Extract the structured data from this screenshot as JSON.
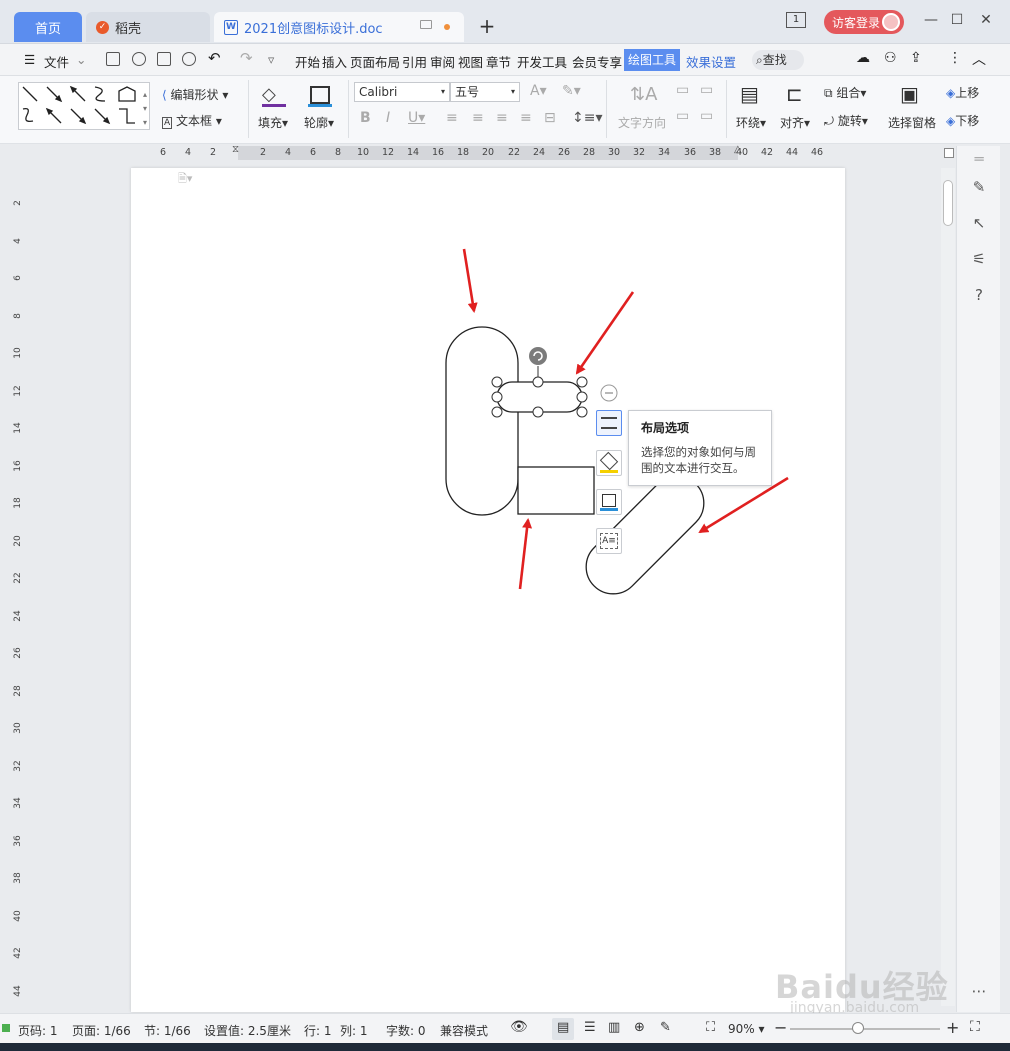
{
  "tabs": {
    "home": "首页",
    "daoke": "稻壳",
    "doc": "2021创意图标设计.doc",
    "new_tab": "+"
  },
  "header": {
    "page_badge": "1",
    "login": "访客登录"
  },
  "menu": {
    "file": "文件",
    "items": [
      "开始",
      "插入",
      "页面布局",
      "引用",
      "审阅",
      "视图",
      "章节",
      "开发工具",
      "会员专享"
    ],
    "drawing_tools": "绘图工具",
    "effect_settings": "效果设置",
    "search": "查找"
  },
  "ribbon": {
    "edit_shape": "编辑形状",
    "text_box": "文本框",
    "fill": "填充",
    "outline": "轮廓",
    "font_name": "Calibri",
    "font_size": "五号",
    "text_direction": "文字方向",
    "wrap": "环绕",
    "align": "对齐",
    "group": "组合",
    "rotate": "旋转",
    "selection_pane": "选择窗格",
    "bring_up": "上移",
    "send_down": "下移"
  },
  "ruler": {
    "h_left": [
      "6",
      "4",
      "2"
    ],
    "h_main": [
      "2",
      "4",
      "6",
      "8",
      "10",
      "12",
      "14",
      "16",
      "18",
      "20",
      "22",
      "24",
      "26",
      "28",
      "30",
      "32",
      "34",
      "36",
      "38"
    ],
    "h_right": [
      "40",
      "42",
      "44",
      "46"
    ],
    "v": [
      "2",
      "4",
      "6",
      "8",
      "10",
      "12",
      "14",
      "16",
      "18",
      "20",
      "22",
      "24",
      "26",
      "28",
      "30",
      "32",
      "34",
      "36",
      "38",
      "40",
      "42",
      "44"
    ]
  },
  "tooltip": {
    "title": "布局选项",
    "description": "选择您的对象如何与周围的文本进行交互。"
  },
  "statusbar": {
    "page_code": "页码: 1",
    "page": "页面: 1/66",
    "section": "节: 1/66",
    "setting": "设置值: 2.5厘米",
    "row": "行: 1",
    "col": "列: 1",
    "word_count": "字数: 0",
    "compat": "兼容模式",
    "zoom": "90%"
  },
  "watermark": {
    "main": "Baidu经验",
    "sub": "jingyan.baidu.com"
  },
  "colors": {
    "accent": "#5b8def",
    "login": "#e4585c",
    "arrow": "#e02020"
  }
}
